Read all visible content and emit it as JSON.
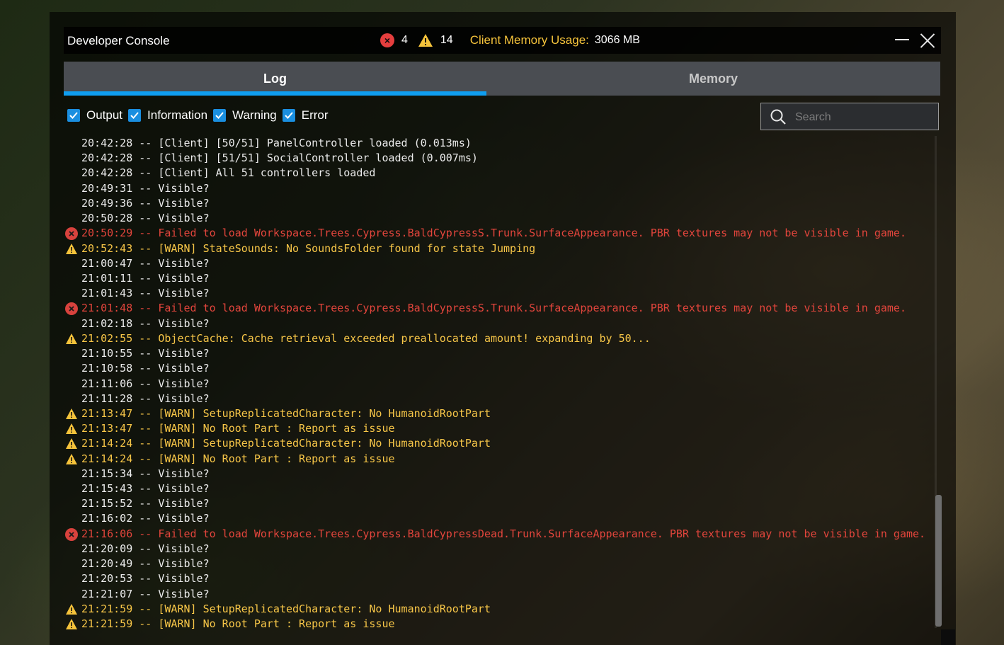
{
  "window": {
    "title": "Developer Console",
    "error_count": "4",
    "warning_count": "14",
    "memory_label": "Client Memory Usage:",
    "memory_value": "3066 MB",
    "minimize_icon": "minimize-icon",
    "close_icon": "close-icon"
  },
  "tabs": [
    {
      "label": "Log",
      "active": true
    },
    {
      "label": "Memory",
      "active": false
    }
  ],
  "filters": [
    {
      "label": "Output",
      "checked": true
    },
    {
      "label": "Information",
      "checked": true
    },
    {
      "label": "Warning",
      "checked": true
    },
    {
      "label": "Error",
      "checked": true
    }
  ],
  "search": {
    "placeholder": "Search",
    "value": ""
  },
  "colors": {
    "accent": "#0f9ef0",
    "error": "#e2453c",
    "warning": "#f7c648",
    "output": "#ececec"
  },
  "log": [
    {
      "type": "output",
      "text": "20:42:28 -- [Client] [50/51] PanelController loaded (0.013ms)"
    },
    {
      "type": "output",
      "text": "20:42:28 -- [Client] [51/51] SocialController loaded (0.007ms)"
    },
    {
      "type": "output",
      "text": "20:42:28 -- [Client] All 51 controllers loaded"
    },
    {
      "type": "output",
      "text": "20:49:31 -- Visible?"
    },
    {
      "type": "output",
      "text": "20:49:36 -- Visible?"
    },
    {
      "type": "output",
      "text": "20:50:28 -- Visible?"
    },
    {
      "type": "error",
      "text": "20:50:29 -- Failed to load Workspace.Trees.Cypress.BaldCypressS.Trunk.SurfaceAppearance. PBR textures may not be visible in game."
    },
    {
      "type": "warning",
      "text": "20:52:43 -- [WARN] StateSounds: No SoundsFolder found for state Jumping"
    },
    {
      "type": "output",
      "text": "21:00:47 -- Visible?"
    },
    {
      "type": "output",
      "text": "21:01:11 -- Visible?"
    },
    {
      "type": "output",
      "text": "21:01:43 -- Visible?"
    },
    {
      "type": "error",
      "text": "21:01:48 -- Failed to load Workspace.Trees.Cypress.BaldCypressS.Trunk.SurfaceAppearance. PBR textures may not be visible in game."
    },
    {
      "type": "output",
      "text": "21:02:18 -- Visible?"
    },
    {
      "type": "warning",
      "text": "21:02:55 -- ObjectCache: Cache retrieval exceeded preallocated amount! expanding by 50..."
    },
    {
      "type": "output",
      "text": "21:10:55 -- Visible?"
    },
    {
      "type": "output",
      "text": "21:10:58 -- Visible?"
    },
    {
      "type": "output",
      "text": "21:11:06 -- Visible?"
    },
    {
      "type": "output",
      "text": "21:11:28 -- Visible?"
    },
    {
      "type": "warning",
      "text": "21:13:47 -- [WARN] SetupReplicatedCharacter: No HumanoidRootPart"
    },
    {
      "type": "warning",
      "text": "21:13:47 -- [WARN] No Root Part : Report as issue"
    },
    {
      "type": "warning",
      "text": "21:14:24 -- [WARN] SetupReplicatedCharacter: No HumanoidRootPart"
    },
    {
      "type": "warning",
      "text": "21:14:24 -- [WARN] No Root Part : Report as issue"
    },
    {
      "type": "output",
      "text": "21:15:34 -- Visible?"
    },
    {
      "type": "output",
      "text": "21:15:43 -- Visible?"
    },
    {
      "type": "output",
      "text": "21:15:52 -- Visible?"
    },
    {
      "type": "output",
      "text": "21:16:02 -- Visible?"
    },
    {
      "type": "error",
      "text": "21:16:06 -- Failed to load Workspace.Trees.Cypress.BaldCypressDead.Trunk.SurfaceAppearance. PBR textures may not be visible in game."
    },
    {
      "type": "output",
      "text": "21:20:09 -- Visible?"
    },
    {
      "type": "output",
      "text": "21:20:49 -- Visible?"
    },
    {
      "type": "output",
      "text": "21:20:53 -- Visible?"
    },
    {
      "type": "output",
      "text": "21:21:07 -- Visible?"
    },
    {
      "type": "warning",
      "text": "21:21:59 -- [WARN] SetupReplicatedCharacter: No HumanoidRootPart"
    },
    {
      "type": "warning",
      "text": "21:21:59 -- [WARN] No Root Part : Report as issue"
    }
  ]
}
